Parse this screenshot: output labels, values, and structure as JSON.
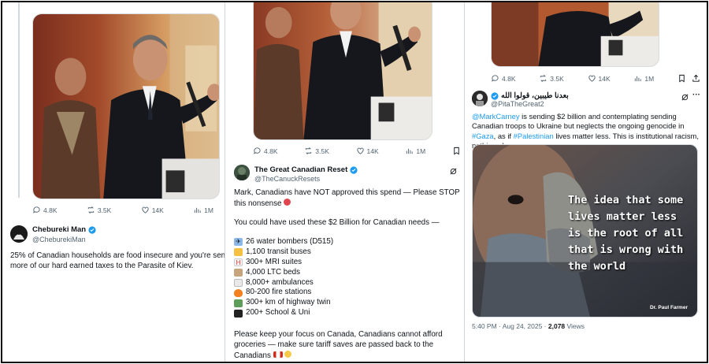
{
  "panel1": {
    "thread_stats": {
      "replies": "4.8K",
      "reposts": "3.5K",
      "likes": "14K",
      "views": "1M"
    },
    "author": {
      "name": "Chebureki Man",
      "handle": "@CheburekiMan"
    },
    "text": "25% of Canadian households are food insecure and you're sen more of our hard earned taxes to the Parasite of Kiev."
  },
  "panel2": {
    "thread_stats": {
      "replies": "4.8K",
      "reposts": "3.5K",
      "likes": "14K",
      "views": "1M"
    },
    "author": {
      "name": "The Great Canadian Reset",
      "handle": "@TheCanuckResets"
    },
    "intro": "Mark, Canadians have NOT approved this spend — Please STOP this nonsense",
    "lead": "You could have used these $2 Billion for Canadian needs —",
    "needs": [
      {
        "emoji": "airplane-emoji",
        "text": "26 water bombers (D515)"
      },
      {
        "emoji": "bus-emoji",
        "text": "1,100 transit buses"
      },
      {
        "emoji": "hospital-emoji",
        "text": "300+ MRI suites"
      },
      {
        "emoji": "house-emoji",
        "text": "4,000 LTC beds"
      },
      {
        "emoji": "ambulance-emoji",
        "text": "8,000+ ambulances"
      },
      {
        "emoji": "fire-emoji",
        "text": "80-200 fire stations"
      },
      {
        "emoji": "road-emoji",
        "text": "300+ km of highway twin"
      },
      {
        "emoji": "graduation-cap-emoji",
        "text": "200+ School & Uni"
      }
    ],
    "closing": "Please keep your focus on Canada, Canadians cannot afford groceries — make sure tariff saves are passed back to the Canadians"
  },
  "panel3": {
    "thread_stats": {
      "replies": "4.8K",
      "reposts": "3.5K",
      "likes": "14K",
      "views": "1M"
    },
    "author": {
      "name": "بعدنا طيبين، قولوا الله",
      "handle": "@PitaTheGreat2"
    },
    "text_parts": {
      "mention": "@MarkCarney",
      "part1": " is sending $2 billion and contemplating sending Canadian troops to Ukraine but neglects the ongoing genocide in ",
      "hashtag1": "#Gaza",
      "part2": ", as if ",
      "hashtag2": "#Palestinian",
      "part3": " lives matter less. This is institutional racism, nothing else."
    },
    "image_quote": "The idea that some lives matter less is the root of all that is wrong with the world",
    "image_signature": "Dr. Paul Farmer",
    "meta": {
      "time": "5:40 PM · Aug 24, 2025 · ",
      "views_count": "2,078",
      "views_label": " Views"
    }
  },
  "colors": {
    "link": "#1d9bf0",
    "verified": "#1d9bf0",
    "muted": "#536471"
  }
}
